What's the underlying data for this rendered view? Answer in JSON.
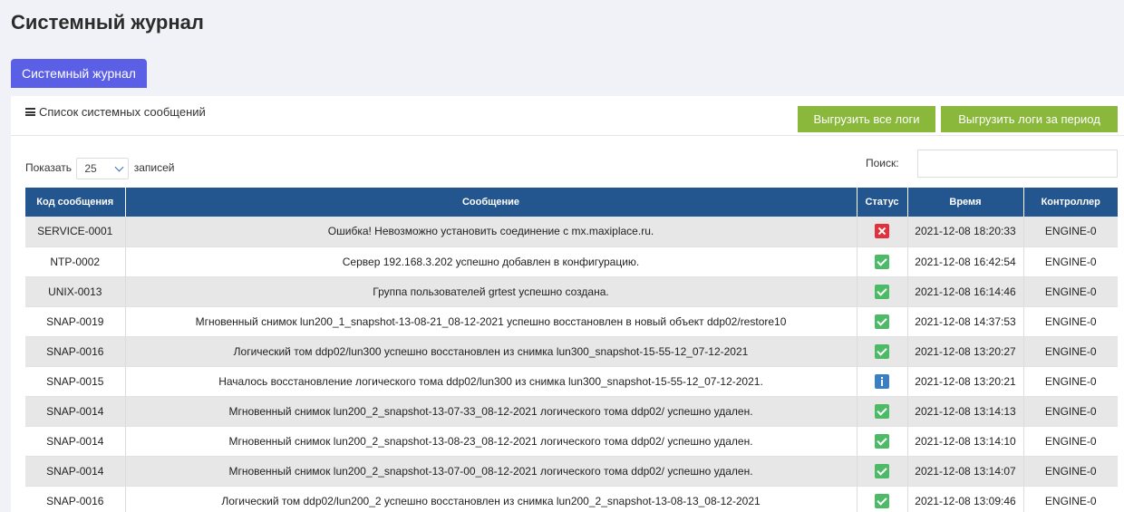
{
  "page_title": "Системный журнал",
  "tab_label": "Системный журнал",
  "panel_title": "Список системных сообщений",
  "buttons": {
    "export_all": "Выгрузить все логи",
    "export_period": "Выгрузить логи за период"
  },
  "length": {
    "prefix": "Показать",
    "value": "25",
    "suffix": "записей"
  },
  "search": {
    "label": "Поиск:",
    "value": ""
  },
  "table": {
    "headers": [
      "Код сообщения",
      "Сообщение",
      "Статус",
      "Время",
      "Контроллер"
    ],
    "rows": [
      {
        "code": "SERVICE-0001",
        "message": "Ошибка! Невозможно установить соединение с mx.maxiplace.ru.",
        "status": "error",
        "time": "2021-12-08 18:20:33",
        "controller": "ENGINE-0"
      },
      {
        "code": "NTP-0002",
        "message": "Сервер 192.168.3.202 успешно добавлен в конфигурацию.",
        "status": "success",
        "time": "2021-12-08 16:42:54",
        "controller": "ENGINE-0"
      },
      {
        "code": "UNIX-0013",
        "message": "Группа пользователей grtest успешно создана.",
        "status": "success",
        "time": "2021-12-08 16:14:46",
        "controller": "ENGINE-0"
      },
      {
        "code": "SNAP-0019",
        "message": "Мгновенный снимок lun200_1_snapshot-13-08-21_08-12-2021 успешно восстановлен в новый объект ddp02/restore10",
        "status": "success",
        "time": "2021-12-08 14:37:53",
        "controller": "ENGINE-0"
      },
      {
        "code": "SNAP-0016",
        "message": "Логический том ddp02/lun300 успешно восстановлен из снимка lun300_snapshot-15-55-12_07-12-2021",
        "status": "success",
        "time": "2021-12-08 13:20:27",
        "controller": "ENGINE-0"
      },
      {
        "code": "SNAP-0015",
        "message": "Началось восстановление логического тома ddp02/lun300 из снимка lun300_snapshot-15-55-12_07-12-2021.",
        "status": "info",
        "time": "2021-12-08 13:20:21",
        "controller": "ENGINE-0"
      },
      {
        "code": "SNAP-0014",
        "message": "Мгновенный снимок lun200_2_snapshot-13-07-33_08-12-2021 логического тома ddp02/ успешно удален.",
        "status": "success",
        "time": "2021-12-08 13:14:13",
        "controller": "ENGINE-0"
      },
      {
        "code": "SNAP-0014",
        "message": "Мгновенный снимок lun200_2_snapshot-13-08-23_08-12-2021 логического тома ddp02/ успешно удален.",
        "status": "success",
        "time": "2021-12-08 13:14:10",
        "controller": "ENGINE-0"
      },
      {
        "code": "SNAP-0014",
        "message": "Мгновенный снимок lun200_2_snapshot-13-07-00_08-12-2021 логического тома ddp02/ успешно удален.",
        "status": "success",
        "time": "2021-12-08 13:14:07",
        "controller": "ENGINE-0"
      },
      {
        "code": "SNAP-0016",
        "message": "Логический том ddp02/lun200_2 успешно восстановлен из снимка lun200_2_snapshot-13-08-13_08-12-2021",
        "status": "success",
        "time": "2021-12-08 13:09:46",
        "controller": "ENGINE-0"
      }
    ]
  },
  "colors": {
    "header_bg": "#23568f",
    "tab_bg": "#5a5fe6",
    "button_green": "#8ab83a",
    "status_error": "#e2313d",
    "status_success": "#4cba66",
    "status_info": "#3a7fc4"
  }
}
